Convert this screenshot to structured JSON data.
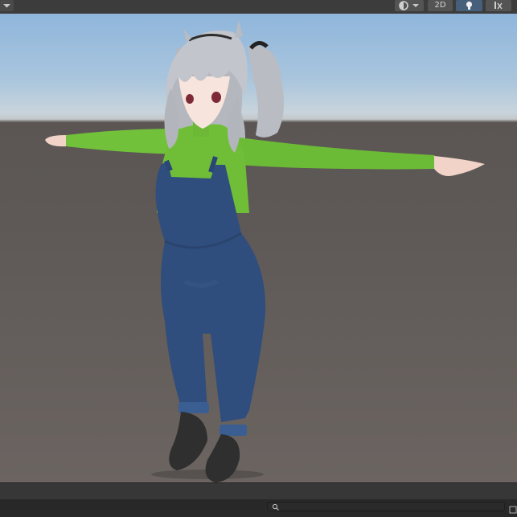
{
  "toolbar": {
    "dropdown_icon": "chevron-down-icon",
    "shading_icon": "shading-mode-icon",
    "mode_2d_label": "2D",
    "lighting_icon": "lightbulb-icon",
    "effects_icon": "scene-effects-icon",
    "active_color": "#46607c"
  },
  "viewport": {
    "skybox_top": "#8fb6dc",
    "ground_color": "#5e5957",
    "model": {
      "hair": "silver",
      "shirt": "green",
      "overalls": "denim blue",
      "shoes": "black"
    }
  },
  "bottom": {
    "search_icon": "search-icon",
    "search_placeholder": ""
  }
}
